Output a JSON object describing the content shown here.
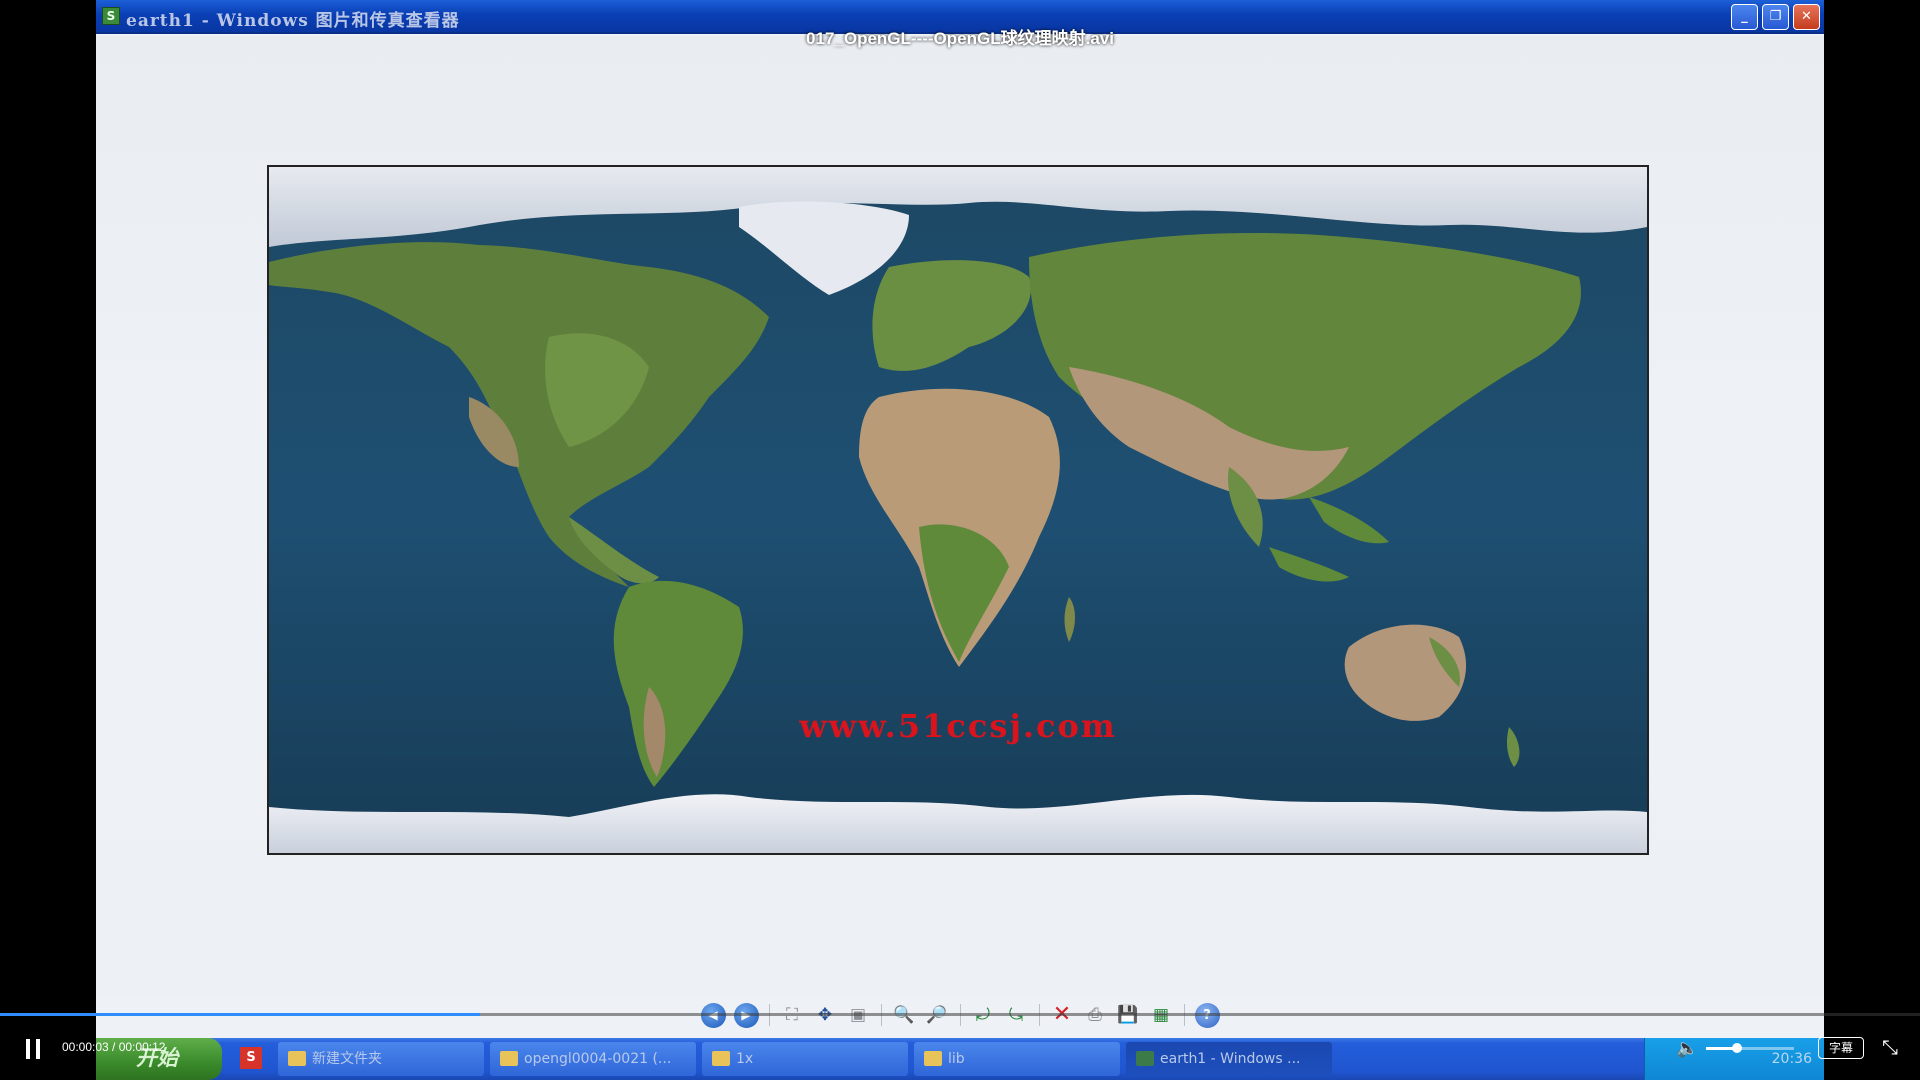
{
  "window": {
    "title": "earth1 - Windows 图片和传真查看器",
    "minimize": "_",
    "restore": "❐",
    "close": "✕"
  },
  "video": {
    "title": "017_OpenGL----OpenGL球纹理映射.avi",
    "time": "00:00:03 / 00:00:12",
    "progress_percent": 25,
    "volume_percent": 35,
    "subtitle_label": "字幕"
  },
  "image": {
    "watermark": "www.51ccsj.com"
  },
  "toolbar": {
    "items": [
      {
        "name": "previous-image-button",
        "icon": "◀"
      },
      {
        "name": "next-image-button",
        "icon": "▶"
      },
      {
        "name": "best-fit-button",
        "icon": "⛶"
      },
      {
        "name": "actual-size-button",
        "icon": "✥"
      },
      {
        "name": "slideshow-button",
        "icon": "▣"
      },
      {
        "name": "zoom-in-button",
        "icon": "🔍"
      },
      {
        "name": "zoom-out-button",
        "icon": "🔎"
      },
      {
        "name": "rotate-clockwise-button",
        "icon": "⤾"
      },
      {
        "name": "rotate-counterclockwise-button",
        "icon": "⤿"
      },
      {
        "name": "delete-button",
        "icon": "✕"
      },
      {
        "name": "print-button",
        "icon": "⎙"
      },
      {
        "name": "save-button",
        "icon": "💾"
      },
      {
        "name": "open-editor-button",
        "icon": "▦"
      },
      {
        "name": "help-button",
        "icon": "?"
      }
    ]
  },
  "taskbar": {
    "start_label": "开始",
    "quick_launch": "S",
    "tasks": [
      "新建文件夹",
      "opengl0004-0021 (...",
      "1x",
      "lib",
      "earth1 - Windows ..."
    ],
    "clock": "20:36"
  }
}
